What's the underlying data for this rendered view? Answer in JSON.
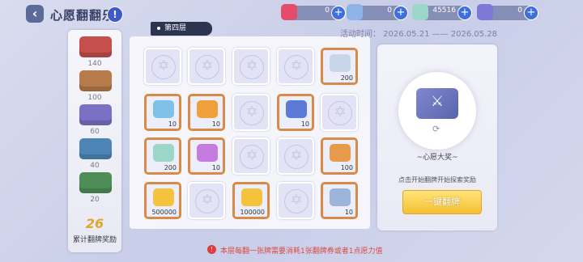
{
  "header": {
    "back_icon": "back-arrow-icon",
    "title": "心愿翻翻乐",
    "info_icon": "info-icon"
  },
  "resources": [
    {
      "name": "ticket",
      "value": "0",
      "color": "#e34d6b"
    },
    {
      "name": "crystal-drop",
      "value": "0",
      "color": "#8fb3e8"
    },
    {
      "name": "gem",
      "value": "45516",
      "color": "#9cd6c9"
    },
    {
      "name": "card-pack",
      "value": "0",
      "color": "#7d79d8"
    }
  ],
  "floor_tab": "第四层",
  "period": "活动时间：  2026.05.21 —— 2026.05.28",
  "chests": [
    {
      "count": "140",
      "color": "#c44f4c"
    },
    {
      "count": "100",
      "color": "#b77a4a"
    },
    {
      "count": "60",
      "color": "#7b70c4"
    },
    {
      "count": "40",
      "color": "#4d86b6"
    },
    {
      "count": "20",
      "color": "#4e8d57"
    }
  ],
  "progress": {
    "value": "26",
    "label": "累计翻牌奖励"
  },
  "grid": [
    [
      {
        "state": "back"
      },
      {
        "state": "back"
      },
      {
        "state": "back"
      },
      {
        "state": "back"
      },
      {
        "state": "open",
        "item": "crystal-icon",
        "qty": "200",
        "color": "#c9d6ea"
      }
    ],
    [
      {
        "state": "open",
        "item": "candy-icon",
        "qty": "10",
        "color": "#7ec0e8"
      },
      {
        "state": "open",
        "item": "amber-icon",
        "qty": "10",
        "color": "#f2a03a"
      },
      {
        "state": "back"
      },
      {
        "state": "open",
        "item": "fish-icon",
        "qty": "10",
        "color": "#5b7ad6"
      },
      {
        "state": "back"
      }
    ],
    [
      {
        "state": "open",
        "item": "gem-icon",
        "qty": "200",
        "color": "#9cd6c9"
      },
      {
        "state": "open",
        "item": "potion-icon",
        "qty": "10",
        "color": "#c57be0"
      },
      {
        "state": "back"
      },
      {
        "state": "back"
      },
      {
        "state": "open",
        "item": "prism-icon",
        "qty": "100",
        "color": "#e79a47"
      }
    ],
    [
      {
        "state": "open",
        "item": "coin-icon",
        "qty": "500000",
        "color": "#f5c23c"
      },
      {
        "state": "back"
      },
      {
        "state": "open",
        "item": "coin-icon",
        "qty": "100000",
        "color": "#f5c23c"
      },
      {
        "state": "back"
      },
      {
        "state": "open",
        "item": "ore-icon",
        "qty": "10",
        "color": "#9db4da"
      }
    ]
  ],
  "right_panel": {
    "card_name": "~心愿大奖~",
    "hint": "点击开始翻牌开始探索奖励",
    "button": "一键翻牌"
  },
  "warning": "本层每翻一张牌需要消耗1张翻牌券或者1点愿力值"
}
